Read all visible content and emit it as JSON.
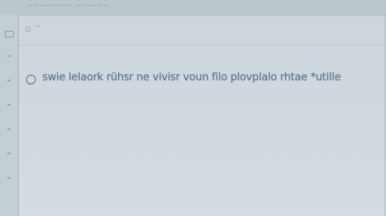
{
  "window": {
    "title": "~~~~~~~~ ~~~~~~"
  },
  "toolbar": {
    "back_icon": "○",
    "chevron_icon": "^"
  },
  "search": {
    "icon": "search-icon",
    "text": "swie lelaork rühsr ne vivisr voun filo plovplalo rhtae *utille"
  },
  "colors": {
    "background": "#cfd8de",
    "text": "#5a6f8c"
  }
}
